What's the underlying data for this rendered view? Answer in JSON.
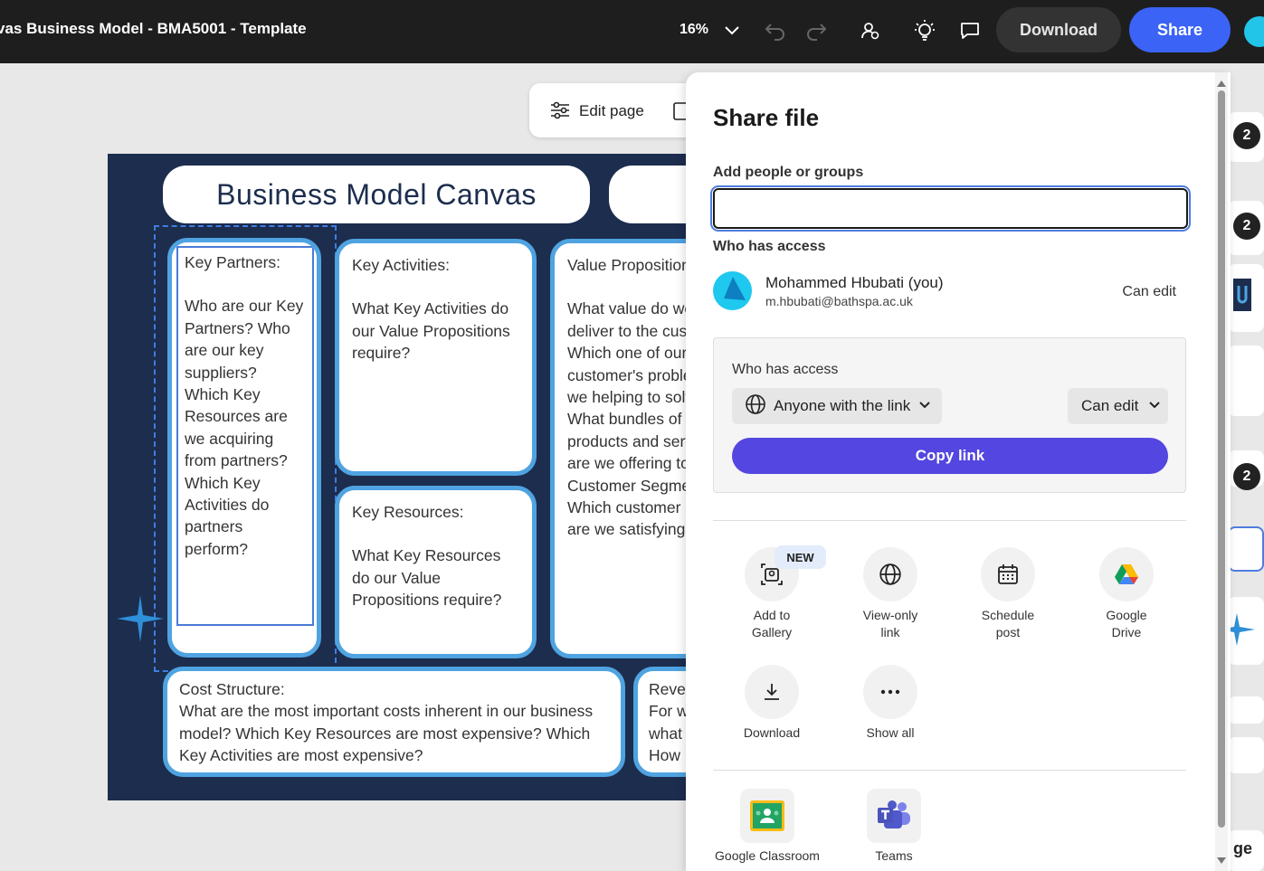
{
  "topbar": {
    "title": "vas Business Model - BMA5001 - Template",
    "zoom": "16%",
    "download_label": "Download",
    "share_label": "Share",
    "accent": "#3b63f6"
  },
  "toolbar": {
    "edit_page_label": "Edit page"
  },
  "canvas": {
    "title": "Business Model Canvas",
    "key_partners": {
      "heading": "Key Partners:",
      "body": "Who are our Key Partners? Who are our key suppliers? Which Key Resources are we acquiring from partners? Which Key Activities do partners perform?"
    },
    "key_activities": {
      "heading": "Key Activities:",
      "body": "What Key Activities do our Value Propositions require?"
    },
    "key_resources": {
      "heading": "Key Resources:",
      "body": "What Key Resources do our Value Propositions require?"
    },
    "value_propositions": {
      "heading": "Value Propositions",
      "body": "What value do we deliver to the customer? Which one of our customer's problems are we helping to solve? What bundles of products and services are we offering to each Customer Segment? Which customer needs are we satisfying?"
    },
    "cost_structure": {
      "heading": "Cost Structure:",
      "body": "What are the most important costs inherent in our business model? Which Key Resources are most expensive? Which Key Activities are most expensive?"
    },
    "revenue": {
      "heading": "Rever",
      "body": "For w what How v"
    }
  },
  "thumbnails": {
    "badges": [
      "2",
      "2",
      "2"
    ],
    "partial_text": "ge"
  },
  "share": {
    "title": "Share file",
    "add_label": "Add people or groups",
    "add_value": "",
    "who_label": "Who has access",
    "person": {
      "name": "Mohammed Hbubati (you)",
      "email": "m.hbubati@bathspa.ac.uk",
      "permission": "Can edit"
    },
    "access": {
      "label": "Who has access",
      "scope": "Anyone with the link",
      "permission": "Can edit",
      "copy_label": "Copy link",
      "copy_color": "#5446e0"
    },
    "options": [
      {
        "label": "Add to Gallery",
        "icon": "gallery-icon",
        "badge": "NEW"
      },
      {
        "label": "View-only link",
        "icon": "globe-icon"
      },
      {
        "label": "Schedule post",
        "icon": "calendar-icon"
      },
      {
        "label": "Google Drive",
        "icon": "google-drive-icon"
      },
      {
        "label": "Download",
        "icon": "download-icon"
      },
      {
        "label": "Show all",
        "icon": "more-icon"
      }
    ],
    "apps": [
      {
        "label": "Google Classroom",
        "icon": "google-classroom-icon"
      },
      {
        "label": "Teams",
        "icon": "teams-icon"
      }
    ]
  }
}
